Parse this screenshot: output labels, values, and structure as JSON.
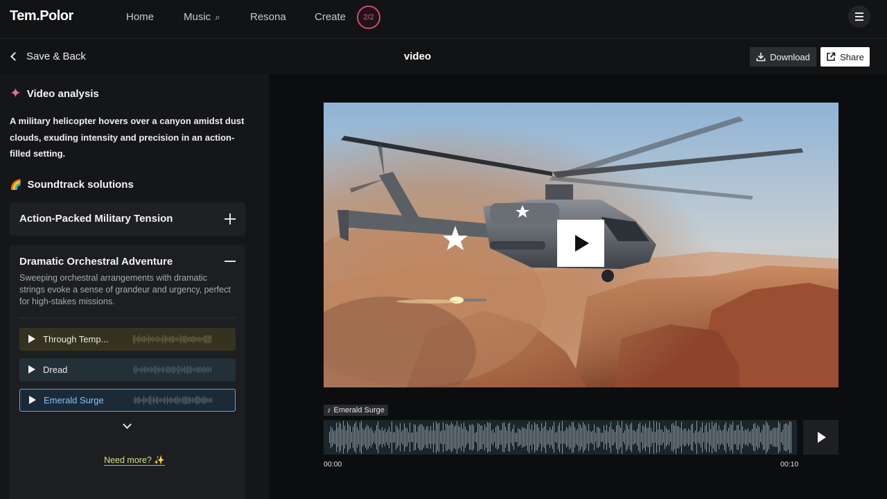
{
  "brand": {
    "logo": "Tem.Polor"
  },
  "nav": {
    "items": [
      {
        "label": "Home"
      },
      {
        "label": "Music",
        "icon": "search-icon"
      },
      {
        "label": "Resona"
      },
      {
        "label": "Create"
      }
    ],
    "credits": "2/2",
    "accent": "#d8457a"
  },
  "subheader": {
    "back_label": "Save & Back",
    "title": "video",
    "download_label": "Download",
    "share_label": "Share"
  },
  "analysis": {
    "heading": "Video analysis",
    "text": "A military helicopter hovers over a canyon amidst dust clouds, exuding intensity and precision in an action-filled setting."
  },
  "soundtrack": {
    "heading": "Soundtrack solutions",
    "solutions": [
      {
        "title": "Action-Packed Military Tension",
        "expanded": false
      },
      {
        "title": "Dramatic Orchestral Adventure",
        "expanded": true,
        "description": "Sweeping orchestral arrangements with dramatic strings evoke a sense of grandeur and urgency, perfect for high-stakes missions.",
        "tracks": [
          {
            "name": "Through Temp...",
            "color": "#35331f"
          },
          {
            "name": "Dread",
            "color": "#243038"
          },
          {
            "name": "Emerald Surge",
            "color": "#1c2a38",
            "selected": true
          }
        ]
      }
    ],
    "need_more": "Need more? ✨"
  },
  "player": {
    "now_playing": "Emerald Surge",
    "time_start": "00:00",
    "time_end": "00:10"
  }
}
